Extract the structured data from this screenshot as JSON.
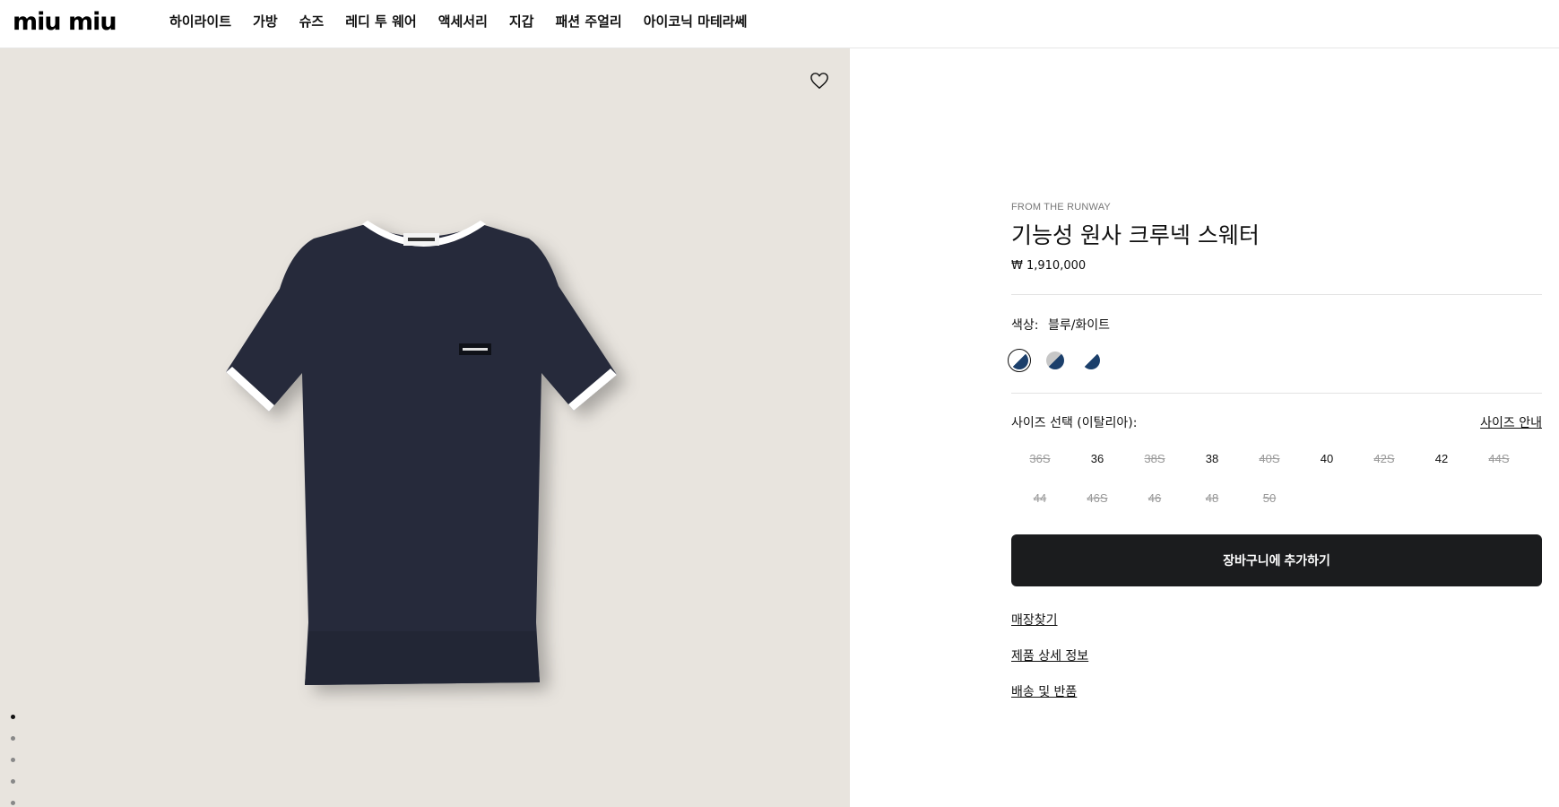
{
  "header": {
    "logo": "miu miu",
    "nav": [
      "하이라이트",
      "가방",
      "슈즈",
      "레디 투 웨어",
      "액세서리",
      "지갑",
      "패션 주얼리",
      "아이코닉 마테라쎄"
    ]
  },
  "product": {
    "eyebrow": "FROM THE RUNWAY",
    "title": "기능성 원사 크루넥 스웨터",
    "price": "₩ 1,910,000",
    "color_label": "색상:",
    "color_value": "블루/화이트",
    "swatches": [
      {
        "name": "navy-white",
        "a": "#1b3f6b",
        "b": "#ffffff",
        "selected": true
      },
      {
        "name": "navy-grey",
        "a": "#1b3f6b",
        "b": "#c7c7c7",
        "selected": false
      },
      {
        "name": "navy-white-alt",
        "a": "#1b3f6b",
        "b": "#ffffff",
        "selected": false
      }
    ],
    "size_label": "사이즈 선택 (이탈리아):",
    "size_guide": "사이즈 안내",
    "sizes": [
      {
        "label": "36S",
        "available": false
      },
      {
        "label": "36",
        "available": true
      },
      {
        "label": "38S",
        "available": false
      },
      {
        "label": "38",
        "available": true
      },
      {
        "label": "40S",
        "available": false
      },
      {
        "label": "40",
        "available": true
      },
      {
        "label": "42S",
        "available": false
      },
      {
        "label": "42",
        "available": true
      },
      {
        "label": "44S",
        "available": false
      },
      {
        "label": "44",
        "available": false
      },
      {
        "label": "46S",
        "available": false
      },
      {
        "label": "46",
        "available": false
      },
      {
        "label": "48",
        "available": false
      },
      {
        "label": "50",
        "available": false
      }
    ],
    "cart_label": "장바구니에 추가하기",
    "links": [
      "매장찾기",
      "제품 상세 정보",
      "배송 및 반품"
    ]
  },
  "colors": {
    "image_bg": "#e8e4de",
    "garment": "#262a3a",
    "trim": "#ffffff",
    "button": "#1b1c1e"
  },
  "gallery": {
    "dots": 5,
    "active": 0
  }
}
